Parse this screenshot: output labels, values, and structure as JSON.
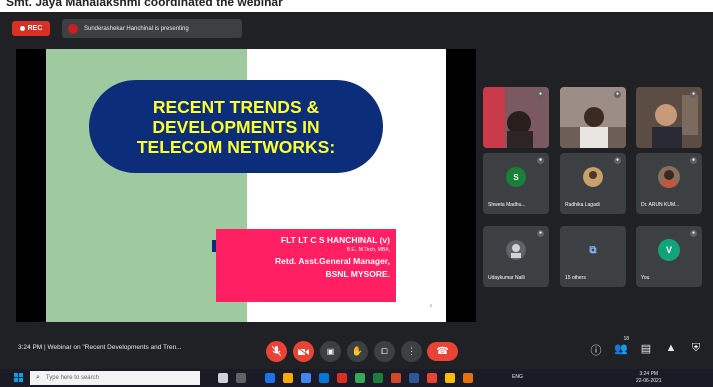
{
  "caption": "Smt. Jaya Mahalakshmi coordinated the webinar",
  "meet": {
    "rec_label": "REC",
    "presenting_text": "Sunderashekar Hanchinal is presenting",
    "slide": {
      "title_lines": [
        "RECENT TRENDS &",
        "DEVELOPMENTS IN",
        "TELECOM NETWORKS:"
      ],
      "name": "FLT LT C S HANCHINAL (v)",
      "degrees": "B.E., M.Tech, MBA,",
      "designation": "Retd. Asst.General Manager,",
      "org": "BSNL MYSORE.",
      "page_number": "2"
    },
    "participants": [
      {
        "name": "",
        "initial": ""
      },
      {
        "name": "",
        "initial": ""
      },
      {
        "name": "",
        "initial": ""
      },
      {
        "name": "Shweta Madhu...",
        "initial": "S"
      },
      {
        "name": "Radhika Lagadi",
        "initial": ""
      },
      {
        "name": "Dr. ARUN KUM...",
        "initial": ""
      },
      {
        "name": "Udaykumar Nalli",
        "initial": ""
      },
      {
        "name": "15 others",
        "initial": ""
      },
      {
        "name": "You",
        "initial": "V"
      }
    ],
    "meeting_time": "3:24 PM",
    "meeting_title": "Webinar on \"Recent Developments and Tren...",
    "people_count": "18",
    "colors": {
      "meet_bg": "#202124",
      "tile_bg": "#3c4043",
      "red": "#ea4335",
      "slide_green": "#9fca9f",
      "slide_navy": "#0c2e7a",
      "slide_yellow": "#ffff2e",
      "slide_pink": "#ff1f62"
    }
  },
  "taskbar": {
    "search_placeholder": "Type here to search",
    "tray_text": "ENG",
    "clock_time": "3:24 PM",
    "clock_date": "22-06-2021"
  }
}
